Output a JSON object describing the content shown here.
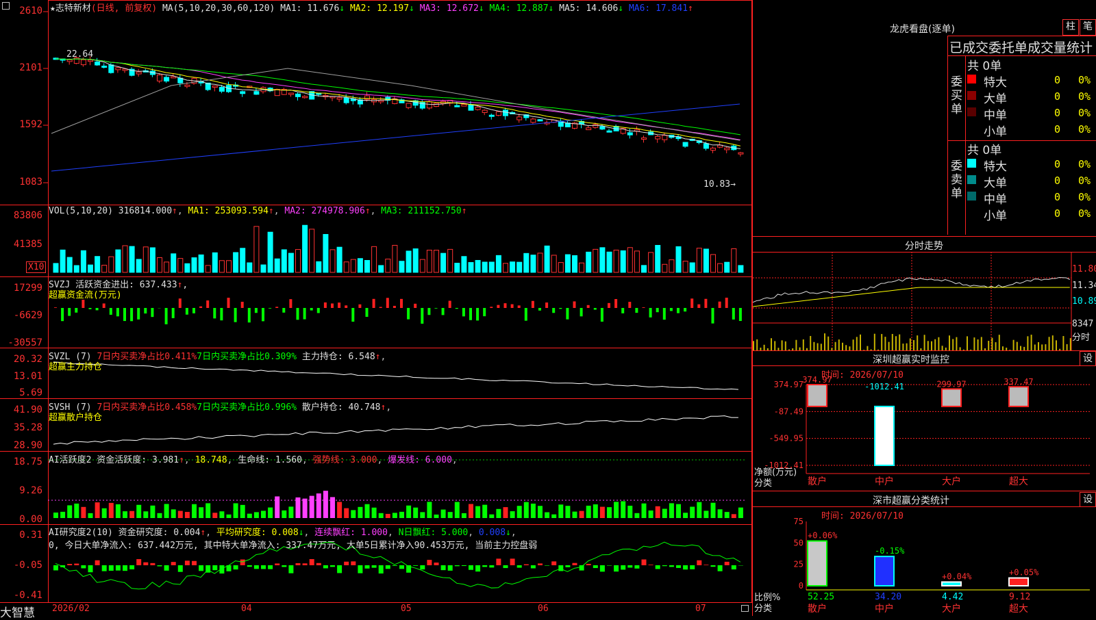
{
  "stock": {
    "star": "★",
    "name": "志特新材",
    "period_label": "(日线, 前复权)"
  },
  "kline": {
    "ma_header": "MA(5,10,20,30,60,120)",
    "ma": [
      {
        "label": "MA1: 11.676",
        "arrow": "↓",
        "color": "#e0e0e0"
      },
      {
        "label": "MA2: 12.197",
        "arrow": "↓",
        "color": "#ffff00"
      },
      {
        "label": "MA3: 12.672",
        "arrow": "↓",
        "color": "#ff40ff"
      },
      {
        "label": "MA4: 12.887",
        "arrow": "↓",
        "color": "#00ff00"
      },
      {
        "label": "MA5: 14.606",
        "arrow": "↓",
        "color": "#e0e0e0"
      },
      {
        "label": "MA6: 17.841",
        "arrow": "↑",
        "color": "#2040ff"
      }
    ],
    "y_ticks": [
      "2610",
      "2101",
      "1592",
      "1083"
    ],
    "high_mark": "22.64",
    "low_mark": "10.83→"
  },
  "vol": {
    "header": "VOL(5,10,20)",
    "value": "316814.000",
    "ma1": "MA1: 253093.594",
    "ma2": "MA2: 274978.906",
    "ma3": "MA3: 211152.750",
    "y_ticks": [
      "83806",
      "41385"
    ],
    "unit": "X10"
  },
  "svzj": {
    "header": "SVZJ  活跃资金进出: 637.433",
    "sub": "超赢资金流(万元)",
    "y_ticks": [
      "17299",
      "-6629",
      "-30557"
    ]
  },
  "svzl": {
    "header": "SVZL (7)",
    "a": "7日内买卖净占比0.411%",
    "b": "7日内买卖净占比0.309%",
    "c": "主力持仓: 6.548",
    "sub": "超赢主力持仓",
    "y_ticks": [
      "20.32",
      "13.01",
      "5.69"
    ]
  },
  "svsh": {
    "header": "SVSH (7)",
    "a": "7日内买卖净占比0.458%",
    "b": "7日内买卖净占比0.996%",
    "c": "散户持仓: 40.748",
    "sub": "超赢散户持仓",
    "y_ticks": [
      "41.90",
      "35.28",
      "28.90"
    ]
  },
  "ai1": {
    "header": "AI活跃度2 资金活跃度: 3.981",
    "v2": "18.748",
    "v3": "生命线: 1.560",
    "v4": "强势线: 3.000",
    "v5": "爆发线: 6.000",
    "y_ticks": [
      "18.75",
      "9.26",
      "0.00"
    ]
  },
  "ai2": {
    "header": "AI研究度2(10) 资金研究度: 0.004",
    "v2": "平均研究度: 0.008",
    "v3": "连续飘红: 1.000",
    "v4": "N日飘红: 5.000",
    "v5": "0.008",
    "line2": "0, 今日大单净流入: 637.442万元, 其中特大单净流入: 337.47万元, 大单5日累计净入90.453万元, 当前主力控盘弱",
    "y_ticks": [
      "0.31",
      "-0.05",
      "-0.41"
    ]
  },
  "x_axis": [
    "2026/02",
    "04",
    "05",
    "06",
    "07"
  ],
  "brand": "大智慧",
  "right": {
    "lhb_title": "龙虎看盘(逐单)",
    "btn_zhu": "柱",
    "btn_bi": "笔",
    "stat_title": "已成交委托单成交量统计",
    "buy": {
      "side": "委买单",
      "total": "共 0单",
      "rows": [
        {
          "name": "特大",
          "n": "0",
          "p": "0%",
          "color": "#ff0000"
        },
        {
          "name": "大单",
          "n": "0",
          "p": "0%",
          "color": "#8b0000"
        },
        {
          "name": "中单",
          "n": "0",
          "p": "0%",
          "color": "#5a0000"
        },
        {
          "name": "小单",
          "n": "0",
          "p": "0%",
          "color": "#000000"
        }
      ]
    },
    "sell": {
      "side": "委卖单",
      "total": "共 0单",
      "rows": [
        {
          "name": "特大",
          "n": "0",
          "p": "0%",
          "color": "#00ffff"
        },
        {
          "name": "大单",
          "n": "0",
          "p": "0%",
          "color": "#008b8b"
        },
        {
          "name": "中单",
          "n": "0",
          "p": "0%",
          "color": "#006a6a"
        },
        {
          "name": "小单",
          "n": "0",
          "p": "0%",
          "color": "#000000"
        }
      ]
    },
    "fenshi": {
      "title": "分时走势",
      "y_ticks": [
        "11.80",
        "11.34",
        "10.89"
      ],
      "vol_tick": "8347",
      "vol_label": "分时"
    },
    "monitor": {
      "title": "深圳超赢实时监控",
      "btn": "设",
      "time": "时间: 2026/07/10",
      "y_ticks": [
        "374.97",
        "-87.49",
        "-549.95",
        "-1012.41"
      ],
      "ylabel": "净额(万元)",
      "xlabel": "分类",
      "cats": [
        "散户",
        "中户",
        "大户",
        "超大"
      ]
    },
    "classify": {
      "title": "深市超赢分类统计",
      "btn": "设",
      "time": "时间: 2026/07/10",
      "y_ticks": [
        "75",
        "50",
        "25",
        "0"
      ],
      "ylabel": "比例%",
      "xlabel": "分类",
      "cats": [
        "散户",
        "中户",
        "大户",
        "超大"
      ]
    }
  },
  "chart_data": [
    {
      "type": "bar",
      "title": "深圳超赢实时监控",
      "xlabel": "分类",
      "ylabel": "净额(万元)",
      "categories": [
        "散户",
        "中户",
        "大户",
        "超大"
      ],
      "values": [
        374.97,
        -1012.41,
        299.97,
        337.47
      ],
      "ylim": [
        -1012.41,
        374.97
      ]
    },
    {
      "type": "bar",
      "title": "深市超赢分类统计",
      "xlabel": "分类",
      "ylabel": "比例%",
      "categories": [
        "散户",
        "中户",
        "大户",
        "超大"
      ],
      "values": [
        52.25,
        34.2,
        4.42,
        9.12
      ],
      "change_labels": [
        "+0.06%",
        "-0.15%",
        "+0.04%",
        "+0.05%"
      ],
      "ylim": [
        0,
        75
      ]
    }
  ]
}
